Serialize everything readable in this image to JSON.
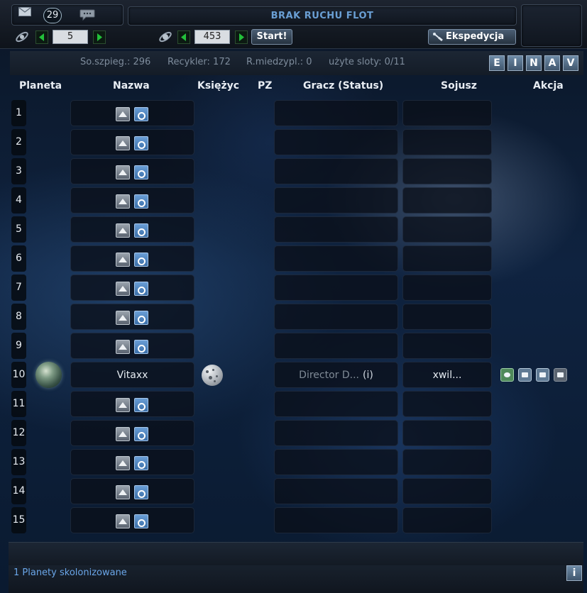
{
  "header": {
    "unread_messages": "29",
    "title": "BRAK RUCHU FLOT"
  },
  "nav": {
    "galaxy": "5",
    "system": "453",
    "start_label": "Start!",
    "expedition_label": "Ekspedycja"
  },
  "stats": {
    "spy": "So.szpieg.: 296",
    "recycler": "Recykler: 172",
    "ipm": "R.miedzypl.: 0",
    "slots": "użyte sloty: 0/11",
    "letters": [
      "E",
      "I",
      "N",
      "A",
      "V"
    ]
  },
  "columns": [
    "Planeta",
    "Nazwa",
    "Księżyc",
    "PZ",
    "Gracz (Status)",
    "Sojusz",
    "Akcja"
  ],
  "rows": [
    {
      "pos": "1"
    },
    {
      "pos": "2"
    },
    {
      "pos": "3"
    },
    {
      "pos": "4"
    },
    {
      "pos": "5"
    },
    {
      "pos": "6"
    },
    {
      "pos": "7"
    },
    {
      "pos": "8"
    },
    {
      "pos": "9"
    },
    {
      "pos": "10",
      "name": "Vitaxx",
      "player": "Director D...",
      "status": "(i)",
      "alliance": "xwil..."
    },
    {
      "pos": "11"
    },
    {
      "pos": "12"
    },
    {
      "pos": "13"
    },
    {
      "pos": "14"
    },
    {
      "pos": "15"
    }
  ],
  "footer": {
    "colonized": "1 Planety skolonizowane",
    "info": "i"
  },
  "colors": {
    "title": "#6a9fd4",
    "footer_text": "#6aa6e8",
    "nav_arrow": "#22c03a"
  }
}
